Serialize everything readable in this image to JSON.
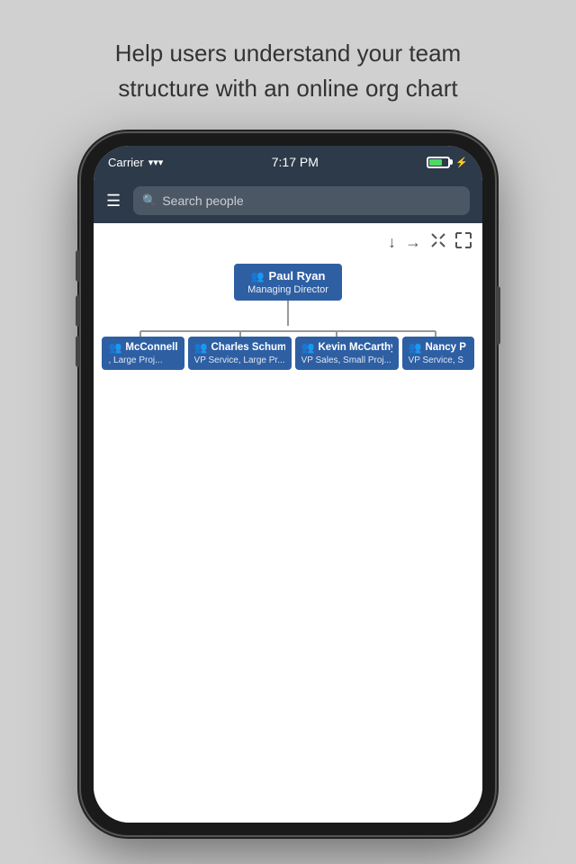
{
  "tagline": {
    "line1": "Help users understand your team",
    "line2": "structure with an online org chart"
  },
  "status_bar": {
    "carrier": "Carrier",
    "wifi": "wifi",
    "time": "7:17 PM",
    "battery_pct": 70
  },
  "nav_bar": {
    "menu_icon": "☰",
    "search_placeholder": "Search people"
  },
  "toolbar": {
    "icons": [
      "↓",
      "→",
      "⤡",
      "⤢"
    ]
  },
  "org_chart": {
    "root": {
      "name": "Paul Ryan",
      "title": "Managing Director"
    },
    "children": [
      {
        "name": "McConnell",
        "name_prefix": "...",
        "title": ", Large Proj...",
        "partial": true
      },
      {
        "name": "Charles Schumer",
        "title": "VP Service, Large Pr...",
        "partial": false
      },
      {
        "name": "Kevin McCarthy",
        "title": "VP Sales, Small Proj...",
        "partial": false
      },
      {
        "name": "Nancy P",
        "name_suffix": "...",
        "title": "VP Service, S",
        "partial_right": true
      }
    ]
  }
}
